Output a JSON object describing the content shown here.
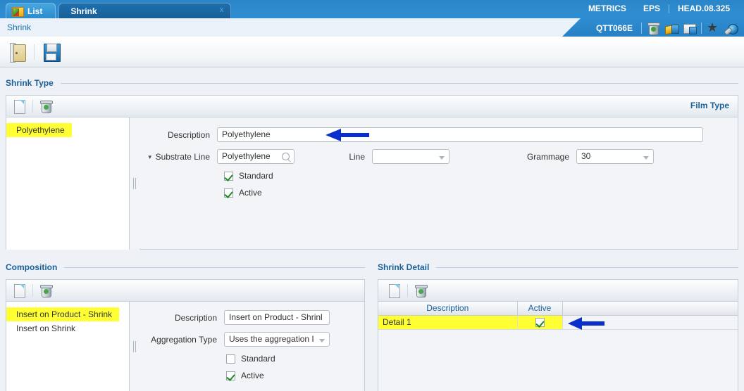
{
  "topbar": {
    "tabs": [
      {
        "label": "List",
        "icon": "folder-icon",
        "active": false
      },
      {
        "label": "Shrink",
        "icon": "",
        "active": true,
        "close": "x"
      }
    ],
    "links": [
      "METRICS",
      "EPS",
      "HEAD.08.325"
    ],
    "metrics_label": "METRICS",
    "eps_label": "EPS",
    "version_label": "HEAD.08.325",
    "breadcrumb": "Shrink",
    "user_code": "QTT066E",
    "icons": [
      "trash-icon",
      "book-icon",
      "screen-icon",
      "star-icon",
      "globe-icon"
    ]
  },
  "toolbar": {
    "exit_icon": "door-exit-icon",
    "save_icon": "save-floppy-icon"
  },
  "shrink_type": {
    "section_title": "Shrink Type",
    "corner_link": "Film Type",
    "new_icon": "new-document-icon",
    "delete_icon": "delete-trash-icon",
    "list_items": [
      {
        "label": "Polyethylene",
        "selected": true
      }
    ],
    "fields": {
      "description_label": "Description",
      "description_value": "Polyethylene",
      "substrate_line_label": "Substrate Line",
      "substrate_line_value": "Polyethylene",
      "line_label": "Line",
      "line_value": "",
      "grammage_label": "Grammage",
      "grammage_value": "30",
      "standard_label": "Standard",
      "standard_checked": true,
      "active_label": "Active",
      "active_checked": true
    }
  },
  "composition": {
    "section_title": "Composition",
    "new_icon": "new-document-icon",
    "delete_icon": "delete-trash-icon",
    "list_items": [
      {
        "label": "Insert on Product - Shrink",
        "selected": true
      },
      {
        "label": "Insert on Shrink",
        "selected": false
      }
    ],
    "fields": {
      "description_label": "Description",
      "description_value": "Insert on Product - Shrinl",
      "aggregation_label": "Aggregation Type",
      "aggregation_value": "Uses the aggregation I",
      "standard_label": "Standard",
      "standard_checked": false,
      "active_label": "Active",
      "active_checked": true
    }
  },
  "shrink_detail": {
    "section_title": "Shrink Detail",
    "new_icon": "new-document-icon",
    "delete_icon": "delete-trash-icon",
    "columns": [
      "Description",
      "Active"
    ],
    "rows": [
      {
        "description": "Detail 1",
        "active": true,
        "selected": true
      }
    ]
  },
  "annotations": {
    "arrow_color": "#0b2fcc",
    "arrows": [
      {
        "name": "description-arrow",
        "target": "shrink-type-description-input"
      },
      {
        "name": "detail-row-arrow",
        "target": "shrink-detail-row"
      }
    ]
  }
}
